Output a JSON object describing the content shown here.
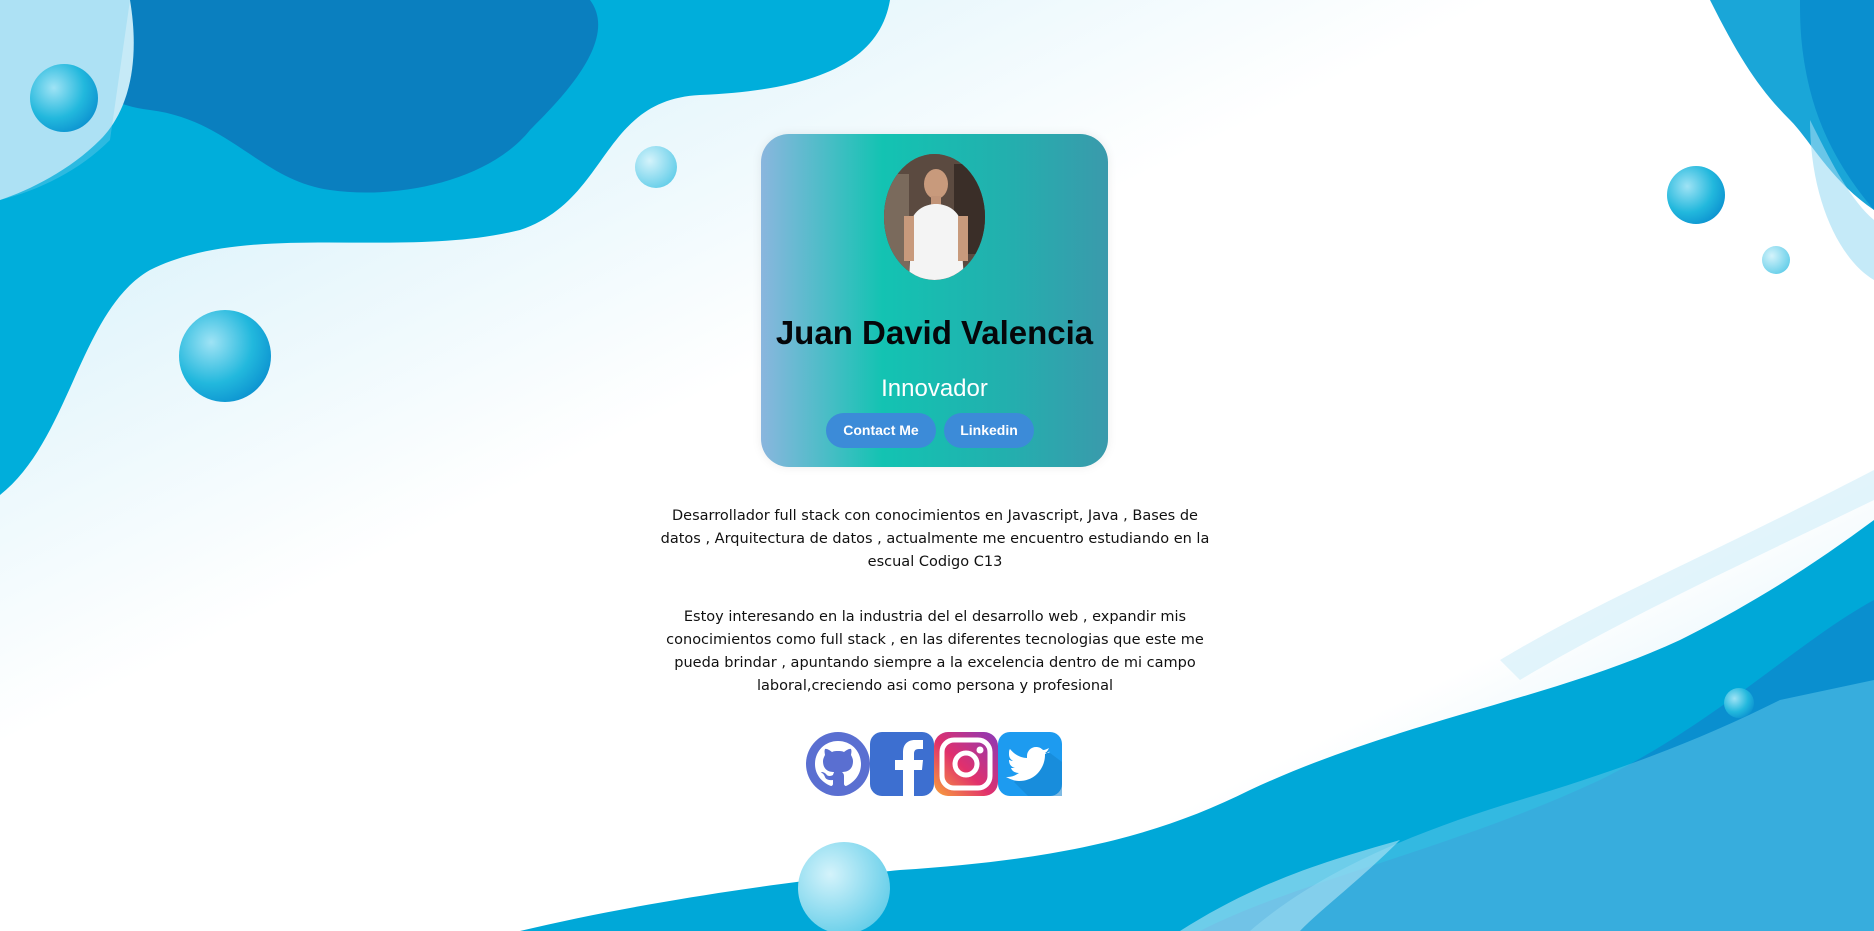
{
  "profile": {
    "name": "Juan David Valencia",
    "role": "Innovador",
    "contact_label": "Contact Me",
    "linkedin_label": "Linkedin"
  },
  "about": {
    "paragraph1": "Desarrollador full stack con conocimientos en Javascript, Java , Bases de datos , Arquitectura de datos , actualmente me encuentro estudiando en la escual Codigo C13",
    "paragraph2": "Estoy interesando en la industria del el desarrollo web , expandir mis conocimientos como full stack , en las diferentes tecnologias que este me pueda brindar , apuntando siempre a la excelencia dentro de mi campo laboral,creciendo asi como persona y profesional"
  },
  "social": [
    {
      "icon": "github-icon",
      "color": "#5a6fd1"
    },
    {
      "icon": "facebook-icon",
      "color": "#3d6fd0"
    },
    {
      "icon": "instagram-icon",
      "color": "#c13584"
    },
    {
      "icon": "twitter-icon",
      "color": "#1d9bf0"
    }
  ],
  "colors": {
    "wave_dark": "#0a86c4",
    "wave_mid": "#00a9d6",
    "wave_light": "#5fc8ea",
    "button": "#3c8bd8"
  }
}
